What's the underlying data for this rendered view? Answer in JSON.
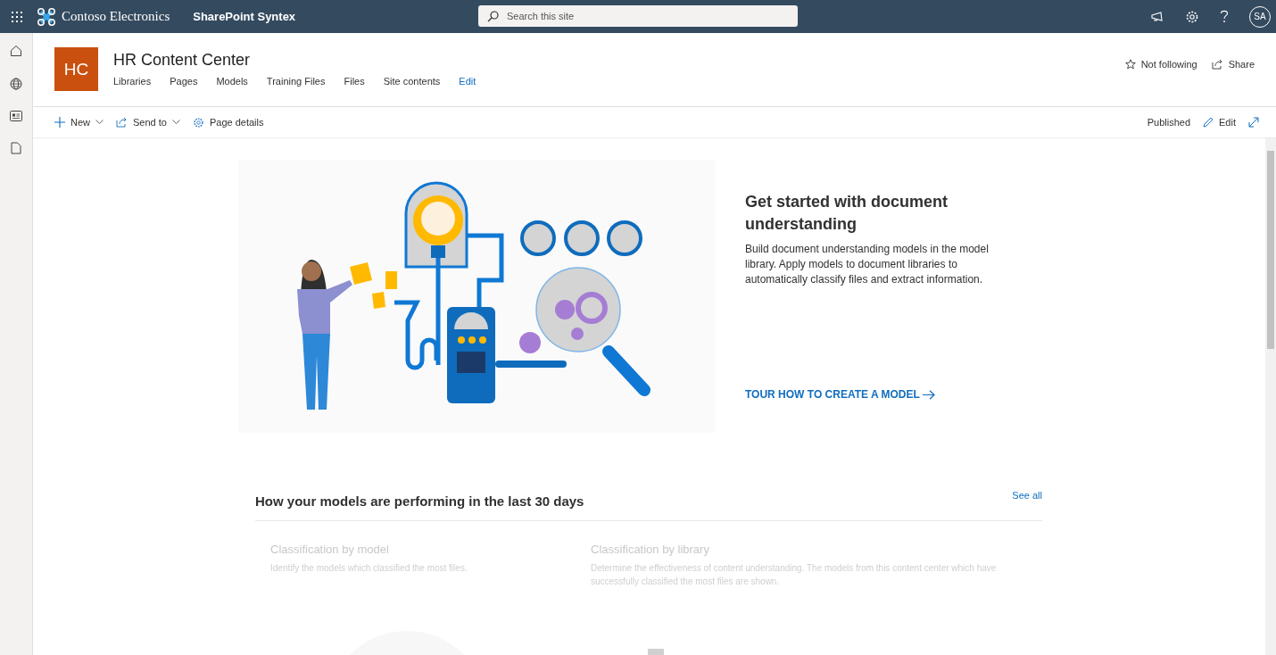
{
  "top_bar": {
    "org": "Contoso Electronics",
    "app": "SharePoint Syntex",
    "search_placeholder": "Search this site",
    "avatar": "SA"
  },
  "site": {
    "logo": "HC",
    "title": "HR Content Center",
    "nav": [
      "Libraries",
      "Pages",
      "Models",
      "Training Files",
      "Files",
      "Site contents"
    ],
    "edit_link": "Edit",
    "follow": "Not following",
    "share": "Share"
  },
  "command_bar": {
    "new": "New",
    "send_to": "Send to",
    "page_details": "Page details",
    "status": "Published",
    "edit": "Edit"
  },
  "hero": {
    "kind": "picture",
    "title": "Get started with document understanding",
    "body": "Build document understanding models in the model library. Apply models to document libraries to automatically classify files and extract information.",
    "link": "TOUR HOW TO CREATE A MODEL"
  },
  "performance": {
    "title": "How your models are performing in the last 30 days",
    "see_all": "See all",
    "cards": [
      {
        "title": "Classification by model",
        "description": "Identify the models which classified the most files."
      },
      {
        "title": "Classification by library",
        "description": "Determine the effectiveness of content understanding. The models from this content center which have successfully classified the most files are shown."
      }
    ]
  }
}
